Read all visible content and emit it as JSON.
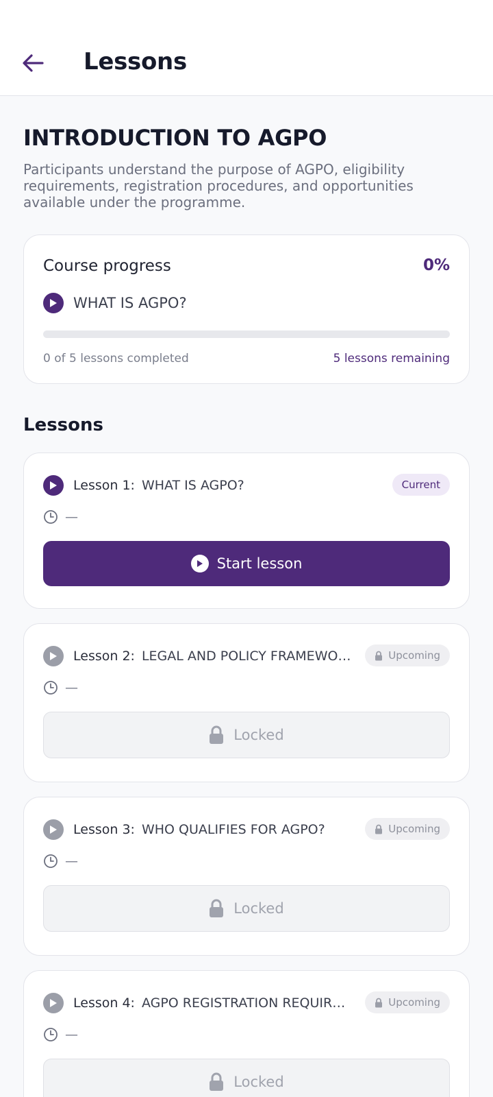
{
  "header": {
    "title": "Lessons"
  },
  "course": {
    "title": "INTRODUCTION TO AGPO",
    "description": "Participants understand the purpose of AGPO, eligibility requirements, registration procedures, and opportunities available under the programme."
  },
  "progress": {
    "label": "Course progress",
    "percent_label": "0%",
    "percent": 0,
    "current_lesson": "WHAT IS AGPO?",
    "completed_text": "0 of 5 lessons completed",
    "remaining_text": "5 lessons remaining"
  },
  "lessons_section": {
    "title": "Lessons",
    "items": [
      {
        "number": "Lesson 1:",
        "name": "WHAT IS AGPO?",
        "status": "Current",
        "duration": "—",
        "action": "Start lesson"
      },
      {
        "number": "Lesson 2:",
        "name": "LEGAL AND POLICY FRAMEWOR…",
        "status": "Upcoming",
        "duration": "—",
        "action": "Locked"
      },
      {
        "number": "Lesson 3:",
        "name": "WHO QUALIFIES FOR AGPO?",
        "status": "Upcoming",
        "duration": "—",
        "action": "Locked"
      },
      {
        "number": "Lesson 4:",
        "name": "AGPO REGISTRATION REQUIREM…",
        "status": "Upcoming",
        "duration": "—",
        "action": "Locked"
      }
    ]
  },
  "colors": {
    "accent": "#4e2a7a",
    "muted": "#9b9ea8",
    "background": "#f8f9fb"
  },
  "icons": {
    "back": "arrow-left-icon",
    "play": "play-circle-icon",
    "clock": "clock-icon",
    "lock": "lock-icon"
  }
}
